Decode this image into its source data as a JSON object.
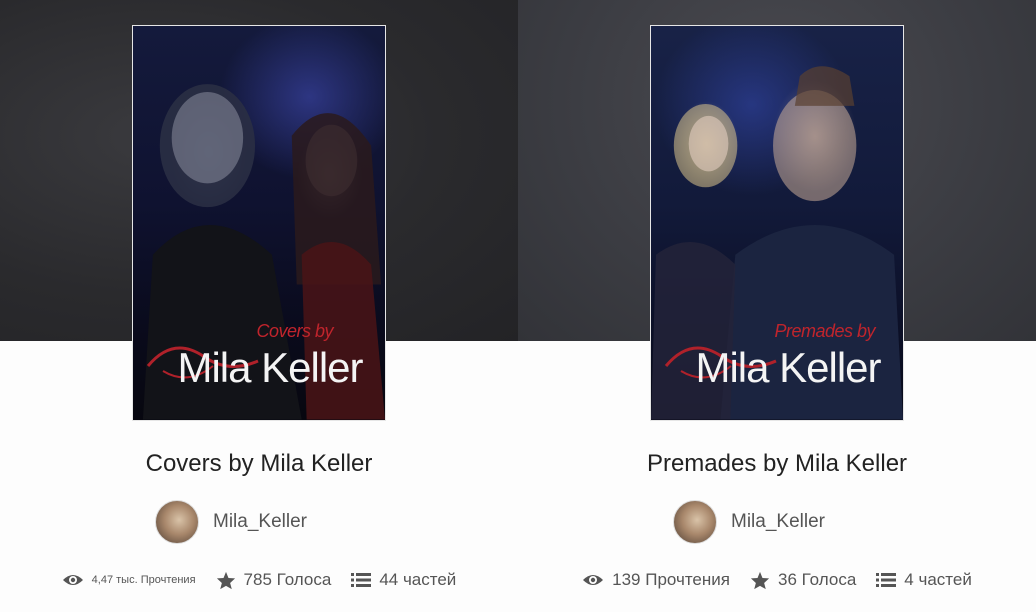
{
  "stories": [
    {
      "cover_subtitle": "Covers by",
      "cover_title": "Mila Keller",
      "title": "Covers by Mila Keller",
      "author": "Mila_Keller",
      "reads": "4,47 тыс. Прочтения",
      "votes": "785 Голоса",
      "parts": "44 частей"
    },
    {
      "cover_subtitle": "Premades by",
      "cover_title": "Mila Keller",
      "title": "Premades by Mila Keller",
      "author": "Mila_Keller",
      "reads": "139 Прочтения",
      "votes": "36 Голоса",
      "parts": "4 частей"
    }
  ],
  "icons": {
    "reads": "eye-icon",
    "votes": "star-icon",
    "parts": "list-icon"
  },
  "colors": {
    "accent_red": "#c0242c",
    "stat_text": "#555555"
  }
}
